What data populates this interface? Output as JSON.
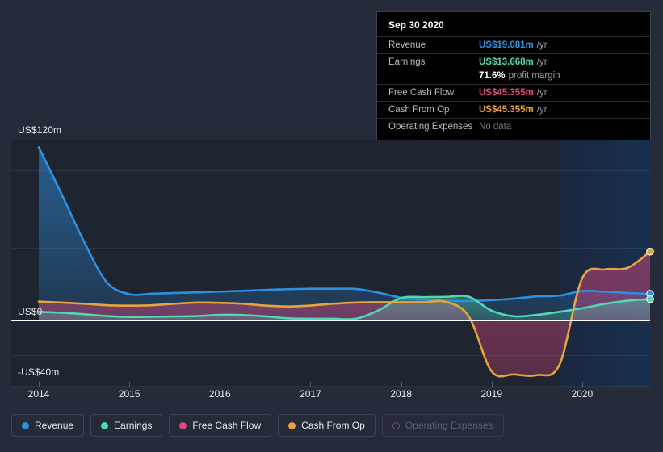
{
  "colors": {
    "revenue": "#2f8fe0",
    "earnings": "#4fd8b3",
    "free_cash_flow": "#e0487f",
    "cash_from_op": "#e8a33d",
    "operating_expenses": "#6a4f8f",
    "background": "#252b38",
    "plot_background": "#1e2430",
    "zero_line": "#ffffff"
  },
  "tooltip": {
    "date": "Sep 30 2020",
    "rows": [
      {
        "label": "Revenue",
        "value": "US$19.081m",
        "unit": "/yr",
        "color_key": "revenue"
      },
      {
        "label": "Earnings",
        "value": "US$13.668m",
        "unit": "/yr",
        "color_key": "earnings"
      },
      {
        "label": "Free Cash Flow",
        "value": "US$45.355m",
        "unit": "/yr",
        "color_key": "free_cash_flow"
      },
      {
        "label": "Cash From Op",
        "value": "US$45.355m",
        "unit": "/yr",
        "color_key": "cash_from_op"
      },
      {
        "label": "Operating Expenses",
        "value": "No data",
        "unit": "",
        "color_key": "none"
      }
    ],
    "profit_margin_value": "71.6%",
    "profit_margin_label": "profit margin"
  },
  "legend": [
    {
      "label": "Revenue",
      "color_key": "revenue",
      "enabled": true
    },
    {
      "label": "Earnings",
      "color_key": "earnings",
      "enabled": true
    },
    {
      "label": "Free Cash Flow",
      "color_key": "free_cash_flow",
      "enabled": true
    },
    {
      "label": "Cash From Op",
      "color_key": "cash_from_op",
      "enabled": true
    },
    {
      "label": "Operating Expenses",
      "color_key": "operating_expenses",
      "enabled": false
    }
  ],
  "axis": {
    "y_top_label": "US$120m",
    "y_zero_label": "US$0",
    "y_bottom_label": "-US$40m",
    "x_labels": [
      "2014",
      "2015",
      "2016",
      "2017",
      "2018",
      "2019",
      "2020"
    ]
  },
  "chart_data": {
    "type": "area",
    "title": "",
    "xlabel": "",
    "ylabel": "US$",
    "ylim": [
      -40,
      120
    ],
    "xlim": [
      2014,
      2020.75
    ],
    "grid": true,
    "legend_position": "bottom",
    "x": [
      2014.0,
      2014.25,
      2014.5,
      2014.75,
      2015.0,
      2015.25,
      2015.5,
      2015.75,
      2016.0,
      2016.25,
      2016.5,
      2016.75,
      2017.0,
      2017.25,
      2017.5,
      2017.75,
      2018.0,
      2018.25,
      2018.5,
      2018.75,
      2019.0,
      2019.25,
      2019.5,
      2019.75,
      2020.0,
      2020.25,
      2020.5,
      2020.75
    ],
    "x_tick_labels": [
      "2014",
      "2015",
      "2016",
      "2017",
      "2018",
      "2019",
      "2020"
    ],
    "series": [
      {
        "name": "Revenue",
        "color": "#2f8fe0",
        "values": [
          115.0,
          84.0,
          52.0,
          25.0,
          17.0,
          17.3,
          17.8,
          18.2,
          18.7,
          19.2,
          19.8,
          20.3,
          20.6,
          20.6,
          20.5,
          18.0,
          14.6,
          13.2,
          12.6,
          12.4,
          13.0,
          14.0,
          15.5,
          16.0,
          19.081,
          18.6,
          17.8,
          17.2
        ]
      },
      {
        "name": "Earnings",
        "color": "#4fd8b3",
        "values": [
          5.2,
          4.6,
          3.6,
          2.4,
          1.8,
          1.9,
          2.1,
          2.4,
          3.2,
          3.1,
          2.2,
          0.9,
          0.6,
          0.6,
          0.6,
          6.2,
          14.4,
          15.0,
          15.2,
          15.2,
          6.0,
          2.2,
          3.2,
          5.2,
          7.6,
          10.5,
          12.6,
          13.668
        ]
      },
      {
        "name": "Free Cash Flow",
        "color": "#e0487f",
        "values": [
          12.0,
          11.4,
          10.6,
          9.6,
          9.3,
          9.6,
          10.6,
          11.4,
          11.2,
          10.6,
          9.4,
          8.8,
          9.4,
          10.6,
          11.4,
          11.6,
          11.6,
          11.6,
          11.8,
          2.0,
          -34.5,
          -36.5,
          -37.0,
          -30.0,
          27.5,
          33.5,
          34.5,
          45.355
        ]
      },
      {
        "name": "Cash From Op",
        "color": "#e8a33d",
        "values": [
          12.0,
          11.4,
          10.6,
          9.6,
          9.3,
          9.6,
          10.6,
          11.4,
          11.2,
          10.6,
          9.4,
          8.8,
          9.4,
          10.6,
          11.4,
          11.6,
          11.6,
          11.6,
          11.8,
          2.0,
          -34.5,
          -36.5,
          -37.0,
          -30.0,
          27.5,
          33.5,
          34.5,
          45.355
        ]
      },
      {
        "name": "Operating Expenses",
        "color": "#6a4f8f",
        "values": [],
        "no_data": true
      }
    ],
    "annotations": {
      "forecast_region_start": "2020",
      "endpoint_markers": [
        "Revenue",
        "Earnings",
        "Cash From Op"
      ]
    }
  }
}
